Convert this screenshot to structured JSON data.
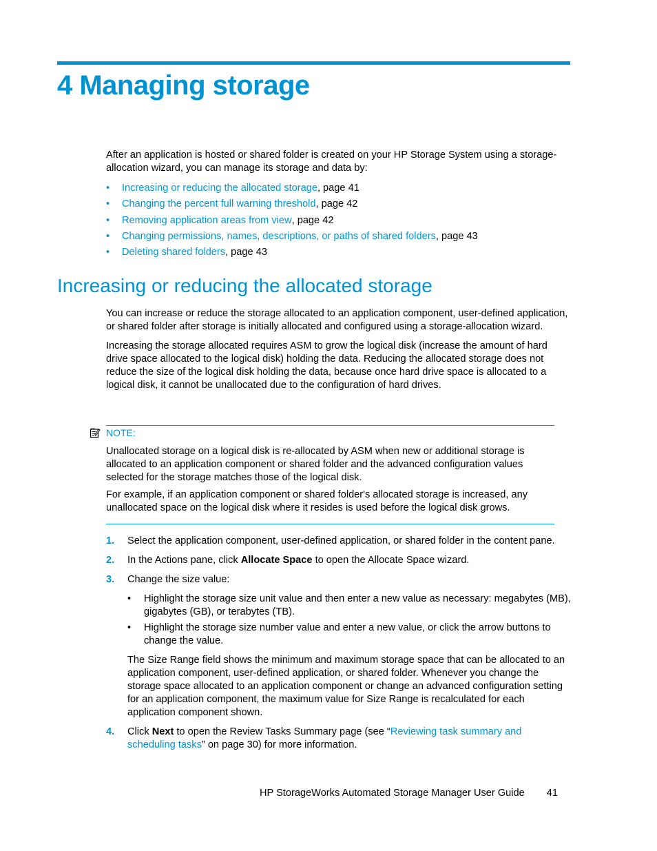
{
  "chapter": {
    "title": "4 Managing storage"
  },
  "intro": {
    "text": "After an application is hosted or shared folder is created on your HP Storage System using a storage-allocation wizard, you can manage its storage and data by:",
    "links": [
      {
        "label": "Increasing or reducing the allocated storage",
        "page": ", page 41"
      },
      {
        "label": "Changing the percent full warning threshold",
        "page": ", page 42"
      },
      {
        "label": "Removing application areas from view",
        "page": ", page 42"
      },
      {
        "label": "Changing permissions, names, descriptions, or paths of shared folders",
        "page": ", page 43"
      },
      {
        "label": "Deleting shared folders",
        "page": ", page 43"
      }
    ],
    "bullet": "•"
  },
  "section": {
    "title": "Increasing or reducing the allocated storage",
    "paragraphs": [
      "You can increase or reduce the storage allocated to an application component, user-defined application, or shared folder after storage is initially allocated and configured using a storage-allocation wizard.",
      "Increasing the storage allocated requires ASM to grow the logical disk (increase the amount of hard drive space allocated to the logical disk) holding the data. Reducing the allocated storage does not reduce the size of the logical disk holding the data, because once hard drive space is allocated to a logical disk, it cannot be unallocated due to the configuration of hard drives."
    ]
  },
  "note": {
    "label": "NOTE:",
    "icon": "note-pad-icon",
    "paragraphs": [
      "Unallocated storage on a logical disk is re-allocated by ASM when new or additional storage is allocated to an application component or shared folder and the advanced configuration values selected for the storage matches those of the logical disk.",
      "For example, if an application component or shared folder's allocated storage is increased, any unallocated space on the logical disk where it resides is used before the logical disk grows."
    ]
  },
  "steps": [
    {
      "num": "1.",
      "text": "Select the application component, user-defined application, or shared folder in the content pane."
    },
    {
      "num": "2.",
      "pre": "In the Actions pane, click ",
      "bold": "Allocate Space",
      "post": " to open the Allocate Space wizard."
    },
    {
      "num": "3.",
      "text": "Change the size value:",
      "subbullets": [
        "Highlight the storage size unit value and then enter a new value as necessary: megabytes (MB), gigabytes (GB), or terabytes (TB).",
        "Highlight the storage size number value and enter a new value, or click the arrow buttons to change the value."
      ],
      "after": "The Size Range field shows the minimum and maximum storage space that can be allocated to an application component, user-defined application, or shared folder. Whenever you change the storage space allocated to an application component or change an advanced configuration setting for an application component, the maximum value for Size Range is recalculated for each application component shown."
    },
    {
      "num": "4.",
      "pre": "Click ",
      "bold": "Next",
      "mid": " to open the Review Tasks Summary page (see “",
      "link": "Reviewing task summary and scheduling tasks",
      "post": "” on page 30) for more information."
    }
  ],
  "footer": {
    "title": "HP StorageWorks Automated Storage Manager User Guide",
    "page": "41"
  }
}
